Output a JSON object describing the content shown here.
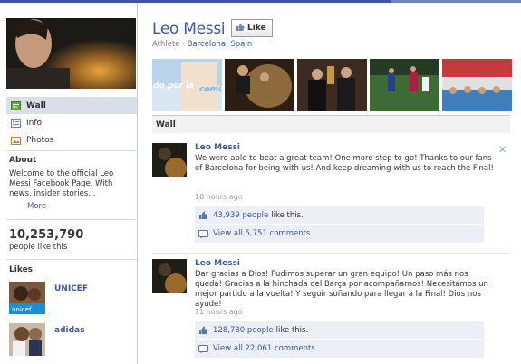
{
  "page": {
    "name": "Leo Messi",
    "category": "Athlete",
    "location": "Barcelona, Spain",
    "like_button": "Like"
  },
  "sidebar": {
    "nav": [
      {
        "label": "Wall",
        "icon": "wall-icon",
        "active": true
      },
      {
        "label": "Info",
        "icon": "info-icon",
        "active": false
      },
      {
        "label": "Photos",
        "icon": "photos-icon",
        "active": false
      }
    ],
    "about_heading": "About",
    "about_text": "Welcome to the official Leo Messi Facebook Page. With news, insider stories...",
    "more_link": "More",
    "likes_count": "10,253,790",
    "likes_label": "people like this",
    "likes_heading": "Likes",
    "liked_pages": [
      {
        "name": "UNICEF"
      },
      {
        "name": "adidas"
      }
    ]
  },
  "wall": {
    "heading": "Wall",
    "posts": [
      {
        "author": "Leo Messi",
        "message": "We were able to beat a great team! One more step to go! Thanks to our fans of Barcelona for being with us! And keep dreaming with us to reach the Final!",
        "time": "10 hours ago",
        "likes_count": "43,939 people",
        "likes_suffix": "like this.",
        "comments": "View all 5,751 comments"
      },
      {
        "author": "Leo Messi",
        "message": "Dar gracias a Dios! Pudimos superar un gran equipo! Un paso más nos queda! Gracias a la hinchada del Barça por acompañarnos! Necesitamos un mejor partido a la vuelta! Y seguir soñando para llegar a la Final! Dios nos ayude!",
        "time": "11 hours ago",
        "likes_count": "128,780 people",
        "likes_suffix": "like this.",
        "comments": "View all 22,061 comments"
      }
    ]
  },
  "colors": {
    "brand_blue": "#3b5998",
    "nav_active": "#d8dfea",
    "like_box": "#eceff5"
  }
}
